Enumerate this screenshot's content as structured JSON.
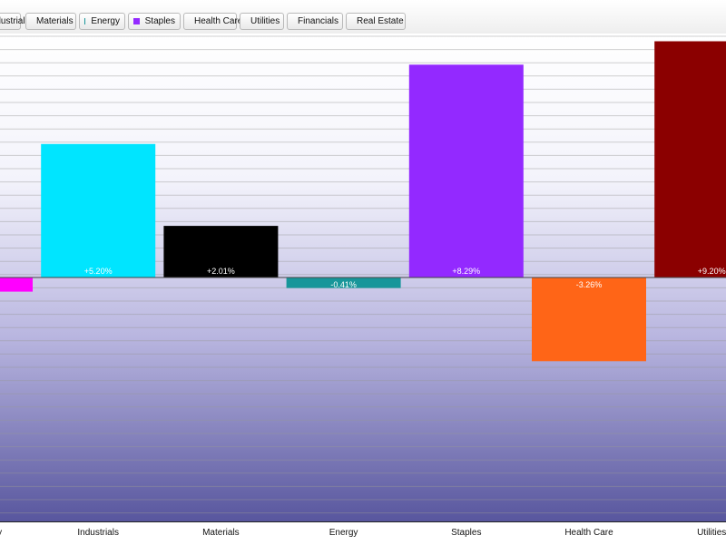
{
  "chart_data": {
    "type": "bar",
    "legend": [
      {
        "label": "Industrials",
        "color": "#00e5ff"
      },
      {
        "label": "Materials",
        "color": "#000000"
      },
      {
        "label": "Energy",
        "color": "#17969a"
      },
      {
        "label": "Staples",
        "color": "#9329ff"
      },
      {
        "label": "Health Care",
        "color": "#ff6517"
      },
      {
        "label": "Utilities",
        "color": "#8b0000"
      },
      {
        "label": "Financials",
        "color": "#3a9bf0"
      },
      {
        "label": "Real Estate",
        "color": "#3c9a1a"
      }
    ],
    "categories": [
      "Discretionary",
      "Industrials",
      "Materials",
      "Energy",
      "Staples",
      "Health Care",
      "Utilities"
    ],
    "values": [
      -0.55,
      5.2,
      2.01,
      -0.41,
      8.29,
      -3.26,
      9.2
    ],
    "value_labels": [
      "",
      "+5.20%",
      "+2.01%",
      "-0.41%",
      "+8.29%",
      "-3.26%",
      "+9.20%"
    ],
    "colors": [
      "#ff00ff",
      "#00e5ff",
      "#000000",
      "#17969a",
      "#9329ff",
      "#ff6517",
      "#8b0000"
    ],
    "ylim": [
      -9.5,
      9.5
    ],
    "grid": true
  }
}
